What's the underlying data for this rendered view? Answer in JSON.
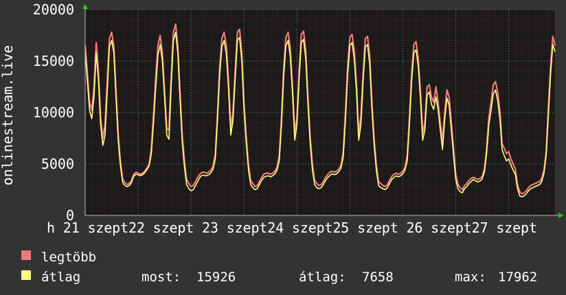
{
  "colors": {
    "background": "#333333",
    "plot_bg": "#1a1a1a",
    "grid_minor": "#6b1f1f",
    "grid_major": "#5a5a5a",
    "axis_arrow": "#22cc22",
    "max_series": "#ef7a7e",
    "avg_series": "#ffff80"
  },
  "chart_data": {
    "type": "area",
    "ylabel": "onlinestream.live",
    "ylim": [
      0,
      20000
    ],
    "y_ticks": [
      0,
      5000,
      10000,
      15000,
      20000
    ],
    "y_tick_labels": [
      "0",
      "5000",
      "10000",
      "15000",
      "20000"
    ],
    "x_label_text": "h 21 szept22 szept 23 szept24 szept25 szept 26 szept27 szept",
    "grid": true,
    "x_points_per_day": 24,
    "series": [
      {
        "name": "legtöbb",
        "color": "#ef7a7e",
        "values": [
          16500,
          13800,
          11000,
          10200,
          12500,
          16800,
          14000,
          9500,
          7500,
          8800,
          13000,
          17200,
          17800,
          16500,
          12000,
          7800,
          5200,
          3500,
          3200,
          3000,
          3100,
          3400,
          4000,
          4200,
          4100,
          4000,
          4100,
          4300,
          4600,
          5000,
          6500,
          9800,
          13500,
          16500,
          17500,
          15800,
          12000,
          8400,
          8300,
          13500,
          17800,
          18600,
          16500,
          12000,
          7800,
          5300,
          3500,
          3100,
          2800,
          2900,
          3300,
          3700,
          4000,
          4200,
          4200,
          4100,
          4200,
          4400,
          4800,
          6000,
          10000,
          14500,
          17200,
          17800,
          16500,
          13000,
          8500,
          10000,
          14000,
          17800,
          18100,
          15800,
          11000,
          7700,
          5000,
          3400,
          3100,
          2800,
          2900,
          3300,
          3700,
          4000,
          4100,
          4100,
          4000,
          4100,
          4300,
          4700,
          5800,
          9500,
          14300,
          17300,
          17800,
          16200,
          12500,
          8000,
          9500,
          14000,
          17600,
          17900,
          16000,
          11500,
          7700,
          5000,
          3400,
          3100,
          2900,
          3000,
          3300,
          3700,
          4000,
          4200,
          4300,
          4200,
          4300,
          4500,
          4900,
          6200,
          10000,
          14500,
          17300,
          17600,
          16000,
          12800,
          8000,
          9600,
          13800,
          17200,
          17400,
          15500,
          11000,
          7400,
          4900,
          3300,
          3100,
          2900,
          2800,
          3000,
          3400,
          3800,
          4000,
          4100,
          4000,
          4100,
          4300,
          4700,
          5800,
          9500,
          13800,
          16600,
          16900,
          15300,
          12000,
          8000,
          9000,
          12500,
          12700,
          11500,
          11000,
          12500,
          11000,
          9000,
          7200,
          10000,
          12200,
          11500,
          9000,
          6500,
          4000,
          3000,
          2700,
          2500,
          2900,
          3100,
          3400,
          3600,
          3700,
          3600,
          3500,
          3600,
          3800,
          4500,
          6500,
          9500,
          11000,
          12700,
          13000,
          12000,
          10200,
          7000,
          6500,
          6000,
          6200,
          5500,
          5000,
          4500,
          3000,
          2300,
          2100,
          2200,
          2400,
          2700,
          2900,
          3000,
          3100,
          3200,
          3300,
          3600,
          4400,
          6200,
          10500,
          14500,
          17400,
          16500
        ]
      },
      {
        "name": "átlag",
        "color": "#ffff80",
        "values": [
          16000,
          13000,
          10200,
          9400,
          11500,
          15800,
          13200,
          8800,
          6800,
          7800,
          12000,
          16400,
          17000,
          15800,
          11300,
          7200,
          4800,
          3200,
          2900,
          2800,
          2900,
          3200,
          3800,
          4000,
          3950,
          3850,
          3950,
          4150,
          4450,
          4800,
          6000,
          9000,
          12500,
          15600,
          16600,
          15000,
          11400,
          7800,
          7400,
          12600,
          17000,
          17800,
          15800,
          11300,
          7100,
          4700,
          3000,
          2600,
          2400,
          2500,
          2900,
          3300,
          3700,
          3900,
          3900,
          3850,
          3950,
          4150,
          4500,
          5500,
          9300,
          13700,
          16400,
          17000,
          15700,
          12200,
          7800,
          9200,
          13200,
          17000,
          17300,
          15000,
          10300,
          7100,
          4500,
          3000,
          2700,
          2500,
          2600,
          3000,
          3400,
          3700,
          3800,
          3850,
          3750,
          3850,
          4050,
          4400,
          5300,
          8800,
          13500,
          16500,
          17000,
          15400,
          11800,
          7300,
          8800,
          13200,
          16800,
          17100,
          15200,
          10800,
          7000,
          4500,
          3000,
          2700,
          2600,
          2700,
          3000,
          3400,
          3700,
          3900,
          4050,
          3950,
          4050,
          4250,
          4600,
          5700,
          9200,
          13700,
          16500,
          16800,
          15200,
          12000,
          7300,
          8800,
          13000,
          16400,
          16600,
          14700,
          10300,
          6800,
          4400,
          2900,
          2700,
          2600,
          2500,
          2700,
          3100,
          3500,
          3700,
          3850,
          3750,
          3850,
          4050,
          4400,
          5300,
          8800,
          13000,
          15800,
          16100,
          14500,
          11300,
          7300,
          8300,
          11700,
          12000,
          10800,
          10300,
          11500,
          10300,
          8300,
          6400,
          9300,
          11400,
          10700,
          8300,
          5800,
          3500,
          2600,
          2300,
          2200,
          2600,
          2800,
          3100,
          3300,
          3500,
          3350,
          3250,
          3350,
          3550,
          4200,
          6000,
          8800,
          10200,
          11800,
          12200,
          11200,
          9400,
          6400,
          5800,
          5300,
          5500,
          4900,
          4400,
          4000,
          2600,
          1900,
          1800,
          1900,
          2100,
          2400,
          2600,
          2700,
          2800,
          2900,
          3000,
          3300,
          4100,
          5800,
          9800,
          13700,
          16600,
          15900
        ]
      }
    ],
    "stats": {
      "current_label": "most:",
      "current_value": "15926",
      "avg_label": "átlag:",
      "avg_value": "7658",
      "max_label": "max:",
      "max_value": "17962"
    }
  }
}
